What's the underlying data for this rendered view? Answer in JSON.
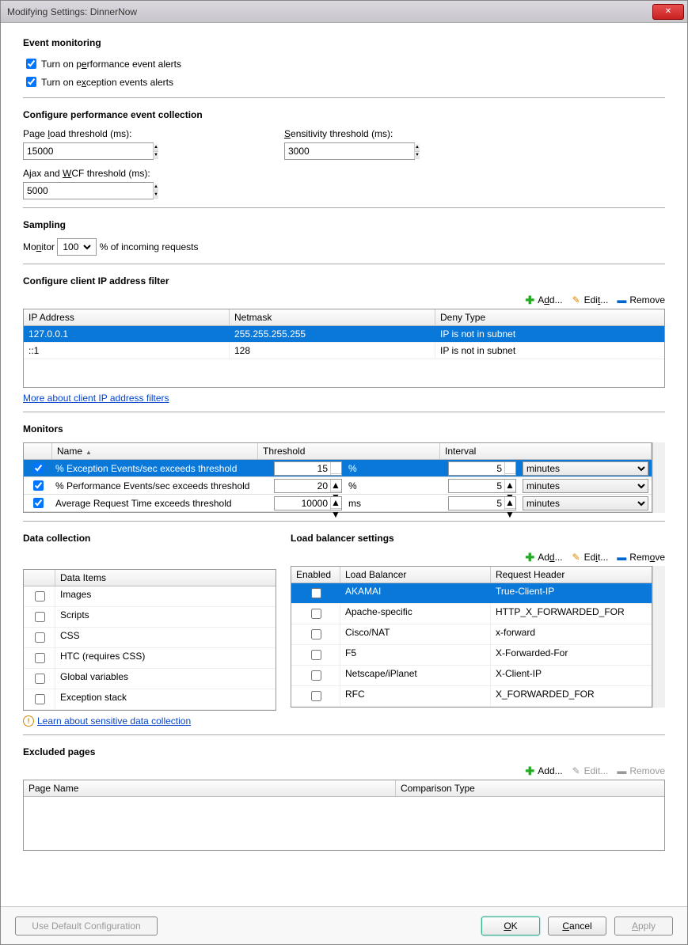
{
  "window": {
    "title": "Modifying Settings: DinnerNow"
  },
  "eventMonitoring": {
    "heading": "Event monitoring",
    "perfAlertsLabel": "Turn on performance event alerts",
    "perfAlertsChecked": true,
    "exceptionAlertsLabel": "Turn on exception events alerts",
    "exceptionAlertsChecked": true
  },
  "perfCollection": {
    "heading": "Configure performance event collection",
    "pageLoadLabel": "Page load threshold (ms):",
    "pageLoadValue": "15000",
    "sensitivityLabel": "Sensitivity threshold (ms):",
    "sensitivityValue": "3000",
    "ajaxLabel": "Ajax and WCF threshold (ms):",
    "ajaxValue": "5000"
  },
  "sampling": {
    "heading": "Sampling",
    "monitorLabel": "Monitor",
    "monitorValue": "100",
    "suffix": "% of incoming requests"
  },
  "ipFilter": {
    "heading": "Configure client IP address filter",
    "addLabel": "Add...",
    "editLabel": "Edit...",
    "removeLabel": "Remove",
    "columns": {
      "ip": "IP Address",
      "netmask": "Netmask",
      "deny": "Deny Type"
    },
    "rows": [
      {
        "ip": "127.0.0.1",
        "netmask": "255.255.255.255",
        "deny": "IP is not in subnet",
        "selected": true
      },
      {
        "ip": "::1",
        "netmask": "128",
        "deny": "IP is not in subnet",
        "selected": false
      }
    ],
    "linkText": "More about client IP address filters"
  },
  "monitors": {
    "heading": "Monitors",
    "columns": {
      "name": "Name",
      "threshold": "Threshold",
      "interval": "Interval"
    },
    "rows": [
      {
        "checked": true,
        "name": "% Exception Events/sec exceeds threshold",
        "threshold": "15",
        "unit": "%",
        "interval": "5",
        "intervalUnit": "minutes",
        "selected": true
      },
      {
        "checked": true,
        "name": "% Performance Events/sec exceeds threshold",
        "threshold": "20",
        "unit": "%",
        "interval": "5",
        "intervalUnit": "minutes",
        "selected": false
      },
      {
        "checked": true,
        "name": "Average Request Time exceeds threshold",
        "threshold": "10000",
        "unit": "ms",
        "interval": "5",
        "intervalUnit": "minutes",
        "selected": false
      }
    ]
  },
  "dataCollection": {
    "heading": "Data collection",
    "columnLabel": "Data Items",
    "items": [
      {
        "label": "Images",
        "checked": false
      },
      {
        "label": "Scripts",
        "checked": false
      },
      {
        "label": "CSS",
        "checked": false
      },
      {
        "label": "HTC (requires CSS)",
        "checked": false
      },
      {
        "label": "Global variables",
        "checked": false
      },
      {
        "label": "Exception stack",
        "checked": false
      }
    ],
    "linkText": "Learn about sensitive data collection"
  },
  "loadBalancer": {
    "heading": "Load balancer settings",
    "addLabel": "Add...",
    "editLabel": "Edit...",
    "removeLabel": "Remove",
    "columns": {
      "enabled": "Enabled",
      "lb": "Load Balancer",
      "header": "Request Header"
    },
    "rows": [
      {
        "enabled": false,
        "lb": "AKAMAI",
        "header": "True-Client-IP",
        "selected": true
      },
      {
        "enabled": false,
        "lb": "Apache-specific",
        "header": "HTTP_X_FORWARDED_FOR",
        "selected": false
      },
      {
        "enabled": false,
        "lb": "Cisco/NAT",
        "header": "x-forward",
        "selected": false
      },
      {
        "enabled": false,
        "lb": "F5",
        "header": "X-Forwarded-For",
        "selected": false
      },
      {
        "enabled": false,
        "lb": "Netscape/iPlanet",
        "header": "X-Client-IP",
        "selected": false
      },
      {
        "enabled": false,
        "lb": "RFC",
        "header": "X_FORWARDED_FOR",
        "selected": false
      }
    ]
  },
  "excluded": {
    "heading": "Excluded pages",
    "addLabel": "Add...",
    "editLabel": "Edit...",
    "removeLabel": "Remove",
    "columns": {
      "name": "Page Name",
      "comp": "Comparison Type"
    }
  },
  "footer": {
    "defaultConfig": "Use Default Configuration",
    "ok": "OK",
    "cancel": "Cancel",
    "apply": "Apply"
  }
}
